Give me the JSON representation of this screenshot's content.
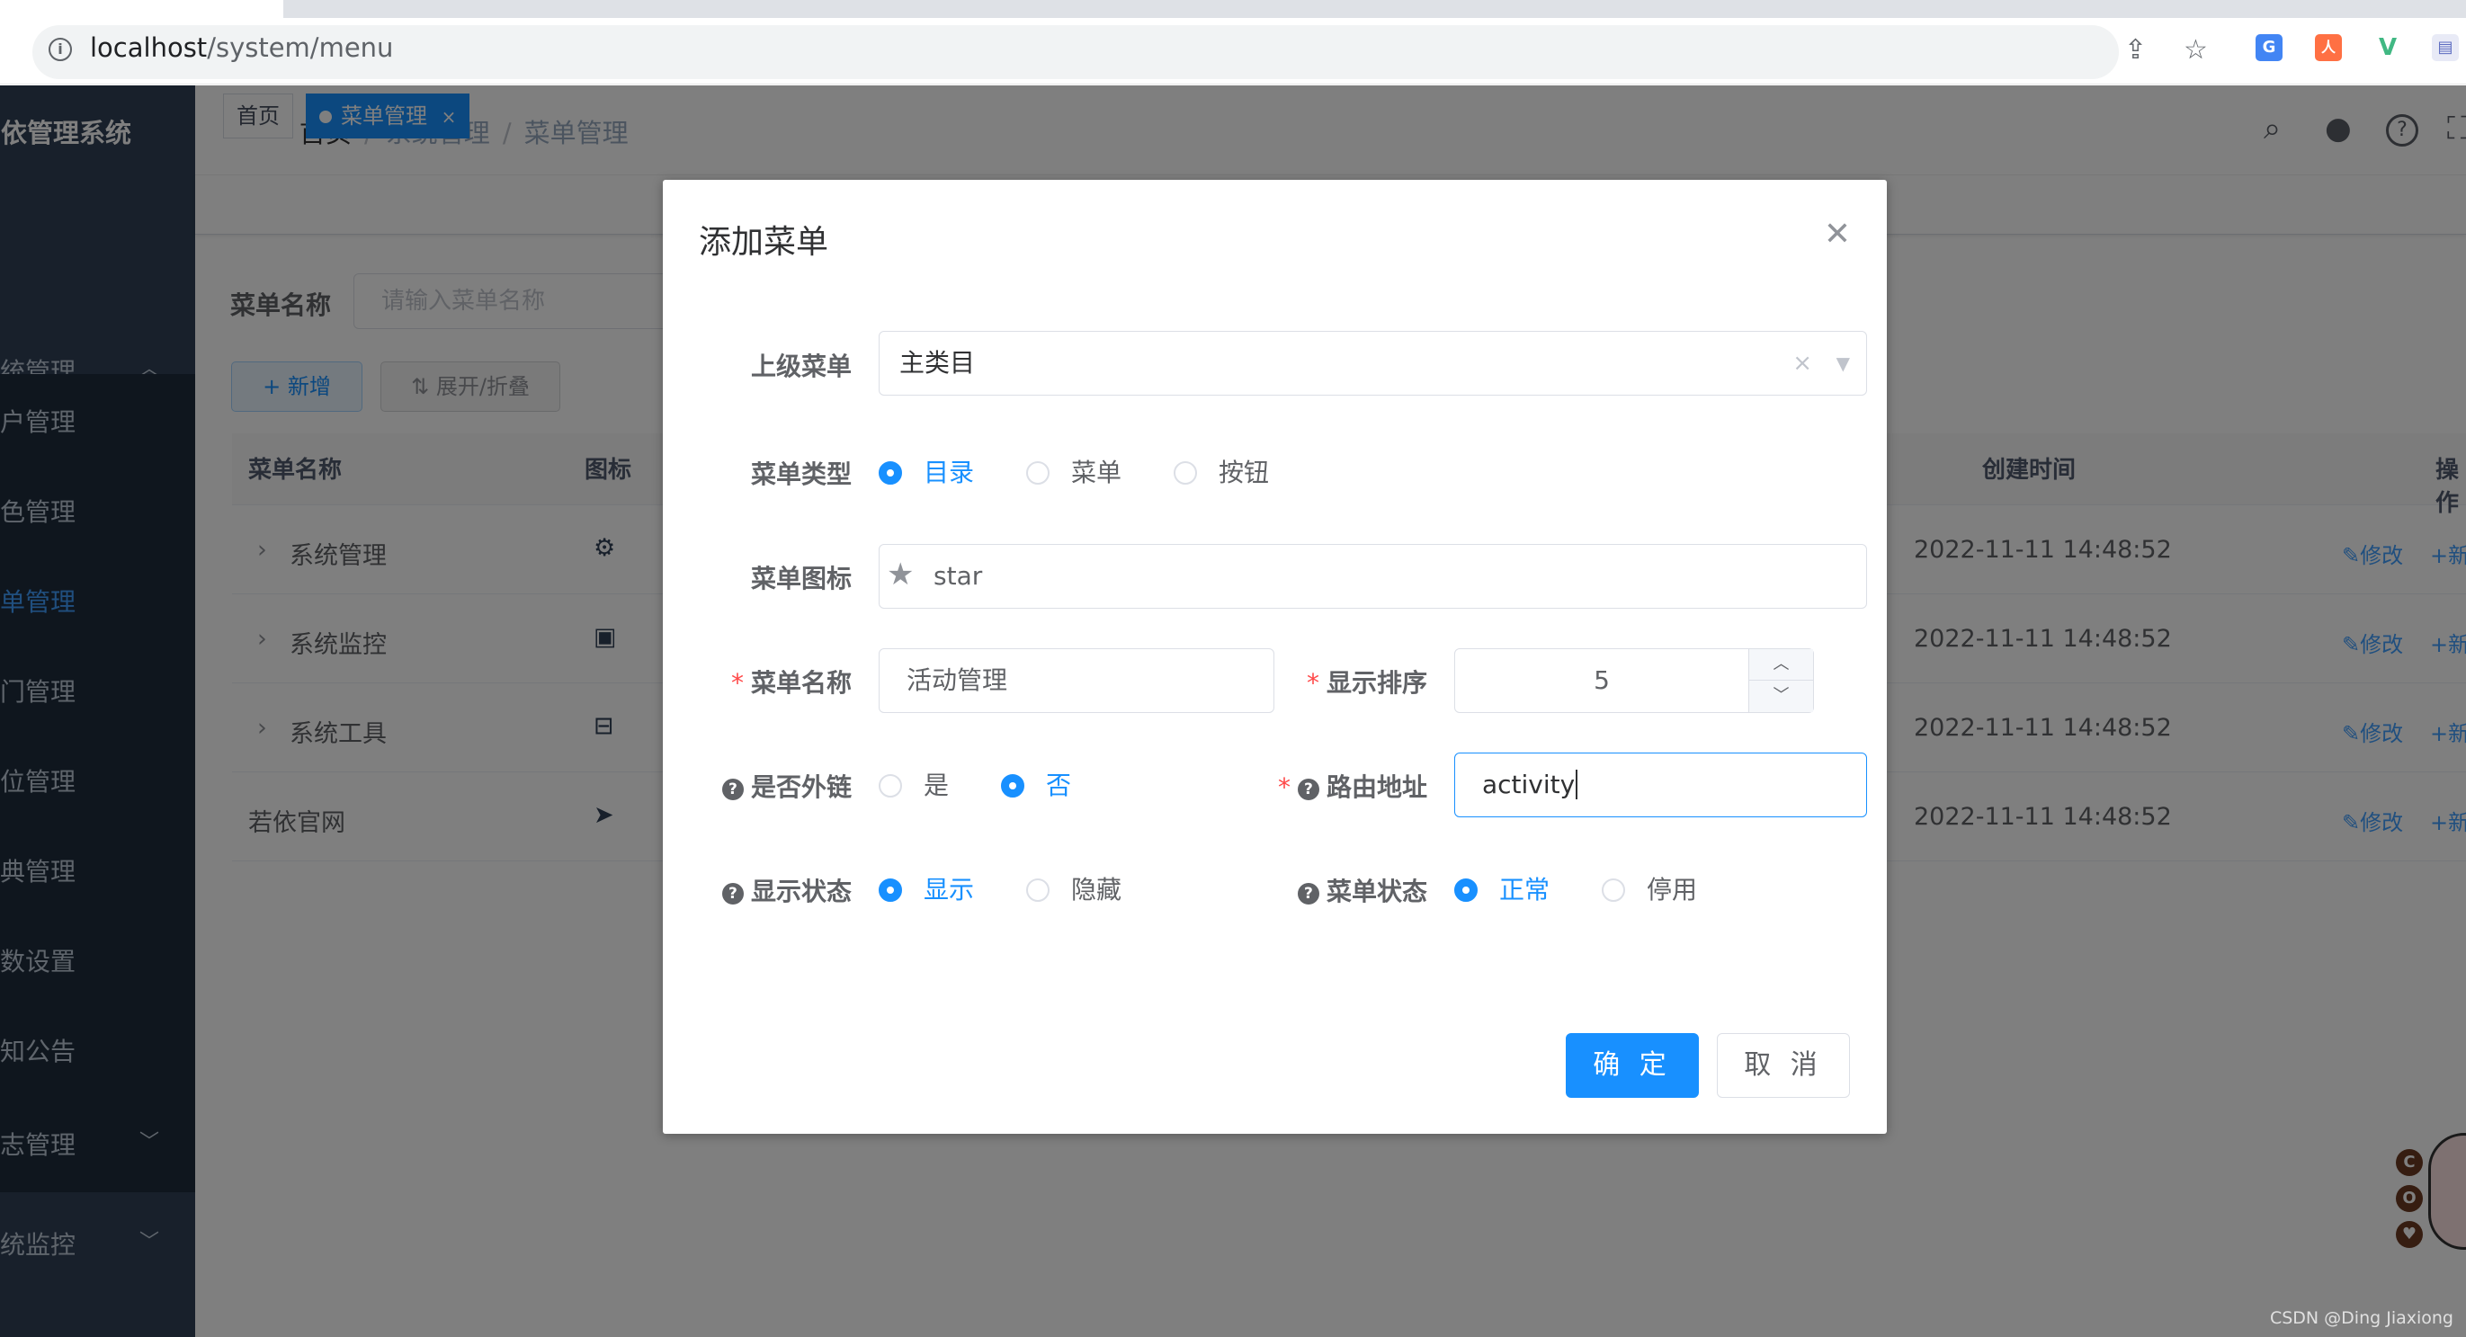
{
  "browser": {
    "url_host": "localhost",
    "url_path": "/system/menu"
  },
  "sidebar": {
    "logo": "若依管理系统",
    "items": [
      {
        "label": "系统管理"
      },
      {
        "label": "用户管理"
      },
      {
        "label": "角色管理"
      },
      {
        "label": "菜单管理"
      },
      {
        "label": "部门管理"
      },
      {
        "label": "岗位管理"
      },
      {
        "label": "字典管理"
      },
      {
        "label": "参数设置"
      },
      {
        "label": "通知公告"
      },
      {
        "label": "日志管理"
      },
      {
        "label": "系统监控"
      }
    ]
  },
  "navbar": {
    "breadcrumb": [
      "首页",
      "系统管理",
      "菜单管理"
    ],
    "separator": "/"
  },
  "tags": {
    "home": "首页",
    "current": "菜单管理",
    "close": "×"
  },
  "search": {
    "label": "菜单名称",
    "placeholder": "请输入菜单名称",
    "add_button": "+ 新增",
    "expand_button": "⇅ 展开/折叠"
  },
  "table": {
    "headers": {
      "name": "菜单名称",
      "icon": "图标",
      "created": "创建时间",
      "ops": "操作"
    },
    "rows": [
      {
        "name": "系统管理",
        "created": "2022-11-11 14:48:52",
        "expand": "›",
        "icon": "gear-icon"
      },
      {
        "name": "系统监控",
        "created": "2022-11-11 14:48:52",
        "expand": "›",
        "icon": "monitor-icon"
      },
      {
        "name": "系统工具",
        "created": "2022-11-11 14:48:52",
        "expand": "›",
        "icon": "toolbox-icon"
      },
      {
        "name": "若依官网",
        "created": "2022-11-11 14:48:52",
        "expand": "",
        "icon": "send-icon"
      }
    ],
    "edit_label": "修改",
    "add_label": "+新增"
  },
  "dialog": {
    "title": "添加菜单",
    "parent_label": "上级菜单",
    "parent_value": "主类目",
    "type_label": "菜单类型",
    "type_options": [
      "目录",
      "菜单",
      "按钮"
    ],
    "type_selected": 0,
    "icon_label": "菜单图标",
    "icon_value": "star",
    "name_label": "菜单名称",
    "name_value": "活动管理",
    "order_label": "显示排序",
    "order_value": "5",
    "external_label": "是否外链",
    "external_options": [
      "是",
      "否"
    ],
    "external_selected": 1,
    "route_label": "路由地址",
    "route_value": "activity",
    "visible_label": "显示状态",
    "visible_options": [
      "显示",
      "隐藏"
    ],
    "visible_selected": 0,
    "status_label": "菜单状态",
    "status_options": [
      "正常",
      "停用"
    ],
    "status_selected": 0,
    "ok": "确 定",
    "cancel": "取 消"
  },
  "watermark": "CSDN @Ding Jiaxiong",
  "colors": {
    "primary": "#1890ff",
    "sidebar": "#304156",
    "required": "#ff4949"
  }
}
